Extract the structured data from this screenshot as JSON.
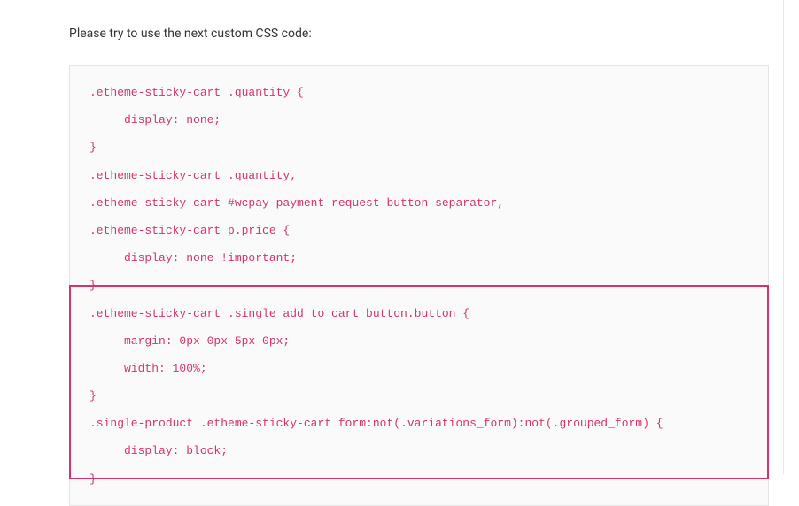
{
  "intro": "Please try to use the next custom CSS code:",
  "code": {
    "lines": [
      ".etheme-sticky-cart .quantity {",
      "     display: none;",
      "}",
      ".etheme-sticky-cart .quantity,",
      ".etheme-sticky-cart #wcpay-payment-request-button-separator,",
      ".etheme-sticky-cart p.price {",
      "     display: none !important;",
      "}",
      ".etheme-sticky-cart .single_add_to_cart_button.button {",
      "     margin: 0px 0px 5px 0px;",
      "     width: 100%;",
      "}",
      ".single-product .etheme-sticky-cart form:not(.variations_form):not(.grouped_form) {",
      "     display: block;",
      "}"
    ]
  }
}
